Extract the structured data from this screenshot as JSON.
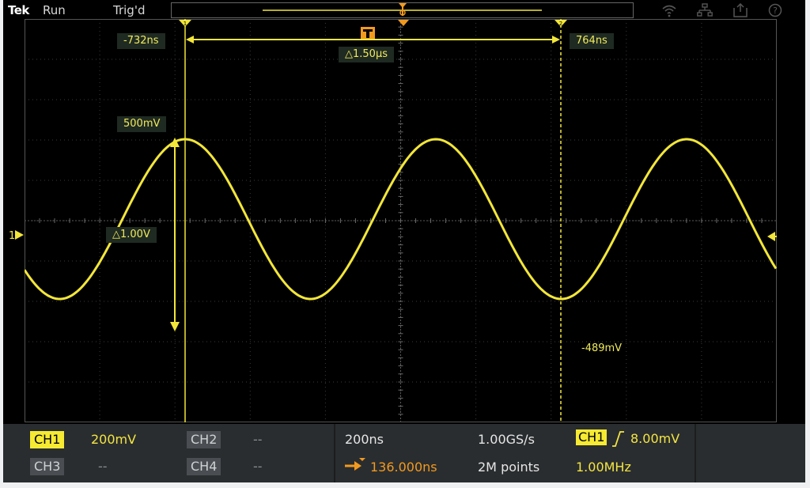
{
  "topbar": {
    "brand": "Tek",
    "run_state": "Run",
    "trigger_state": "Trig'd",
    "icons": [
      "wifi-icon",
      "network-icon",
      "export-icon",
      "help-icon"
    ]
  },
  "readouts": {
    "cursor1_time": "-732ns",
    "cursor2_time": "764ns",
    "delta_time": "△1.50µs",
    "top_level": "500mV",
    "delta_voltage": "△1.00V",
    "min_level": "-489mV",
    "cursor1_marker": "1",
    "cursor2_marker": "2",
    "ch1_marker": "1"
  },
  "waveform": {
    "channel": "CH1",
    "frequency_mhz": 1.0,
    "amplitude_mv": 500,
    "color": "#f2e63a"
  },
  "panel": {
    "ch1_label": "CH1",
    "ch1_scale": "200mV",
    "ch2_label": "CH2",
    "ch2_value": "--",
    "ch3_label": "CH3",
    "ch3_value": "--",
    "ch4_label": "CH4",
    "ch4_value": "--",
    "horiz_scale": "200ns",
    "sample_rate": "1.00GS/s",
    "position": "136.000ns",
    "record_length": "2M points",
    "trigger_source": "CH1",
    "trigger_level": "8.00mV",
    "trigger_freq": "1.00MHz"
  },
  "colors": {
    "trace": "#f2e63a",
    "accent_orange": "#f29a1f",
    "background": "#000000"
  }
}
